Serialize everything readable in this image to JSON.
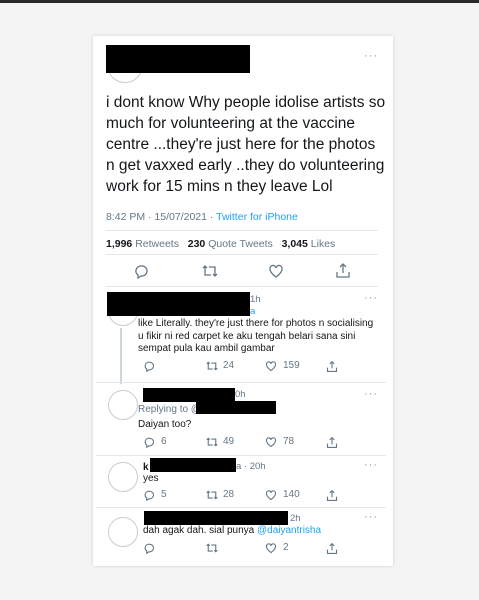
{
  "main_tweet": {
    "text": "i dont know Why people idolise artists so much for volunteering at the vaccine centre ...they're just here for the photos n get vaxxed early ..they do volunteering work for 15 mins n they leave Lol",
    "time": "8:42 PM · 15/07/2021 · ",
    "client": "Twitter for iPhone",
    "retweets": "1,996",
    "retweets_label": "Retweets",
    "quotes": "230",
    "quotes_label": "Quote Tweets",
    "likes": "3,045",
    "likes_label": "Likes",
    "more": "···"
  },
  "replies": [
    {
      "time": "1h",
      "handle_tail": "a",
      "text": "like Literally. they're just there for photos n socialising u fikir ni red carpet ke aku tengah belari sana sini sempat pula kau ambil gambar",
      "retweets": "24",
      "likes": "159",
      "more": "···"
    },
    {
      "time": "0h",
      "replying_to": "Replying to @",
      "text": "Daiyan too?",
      "replies": "6",
      "retweets": "49",
      "likes": "78",
      "more": "···"
    },
    {
      "name_start": "k",
      "time": "a · 20h",
      "text": "yes",
      "replies": "5",
      "retweets": "28",
      "likes": "140",
      "more": "···"
    },
    {
      "time": "2h",
      "text": "dah agak dah. sial punya ",
      "mention": "@daiyantrisha",
      "likes": "2",
      "more": "···"
    }
  ],
  "icons": {
    "reply": "reply-icon",
    "retweet": "retweet-icon",
    "like": "heart-icon",
    "share": "share-icon"
  },
  "colors": {
    "link": "#1da1f2",
    "muted": "#657786",
    "text": "#14171a"
  }
}
